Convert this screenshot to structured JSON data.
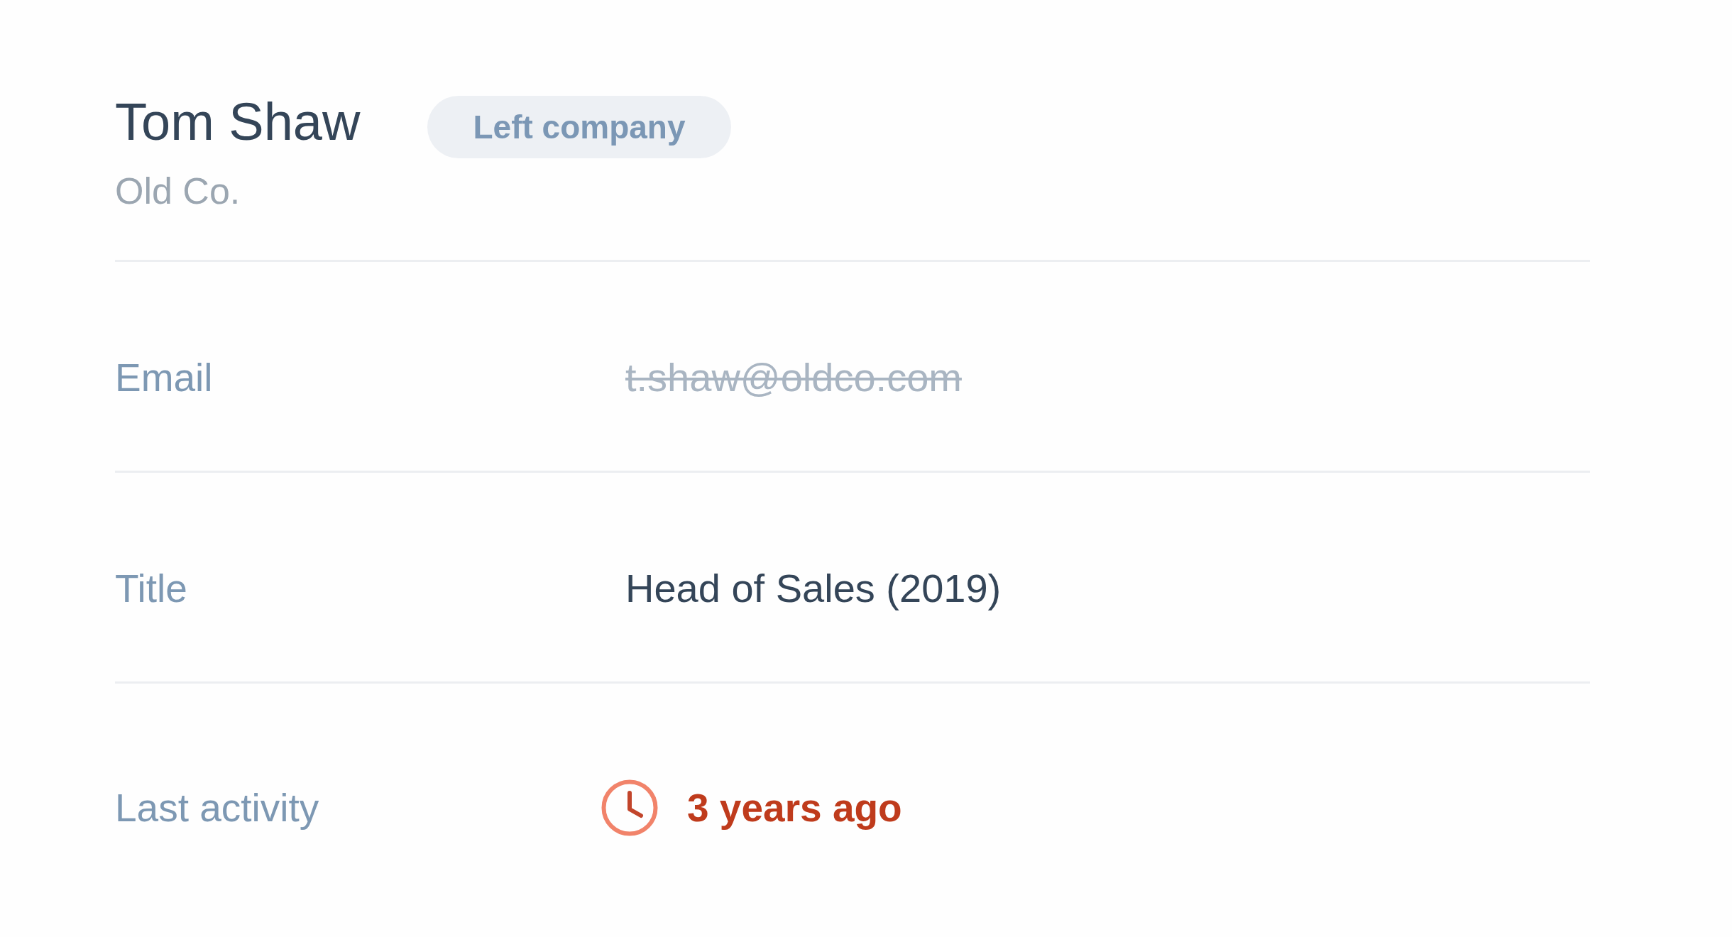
{
  "contact": {
    "name": "Tom Shaw",
    "status_badge": "Left company",
    "company": "Old Co."
  },
  "fields": [
    {
      "kind": "text",
      "label": "Email",
      "value": "t.shaw@oldco.com",
      "struck": true
    },
    {
      "kind": "text",
      "label": "Title",
      "value": "Head of Sales (2019)",
      "struck": false
    },
    {
      "kind": "activity",
      "label": "Last activity",
      "value": "3 years ago",
      "struck": false
    }
  ]
}
